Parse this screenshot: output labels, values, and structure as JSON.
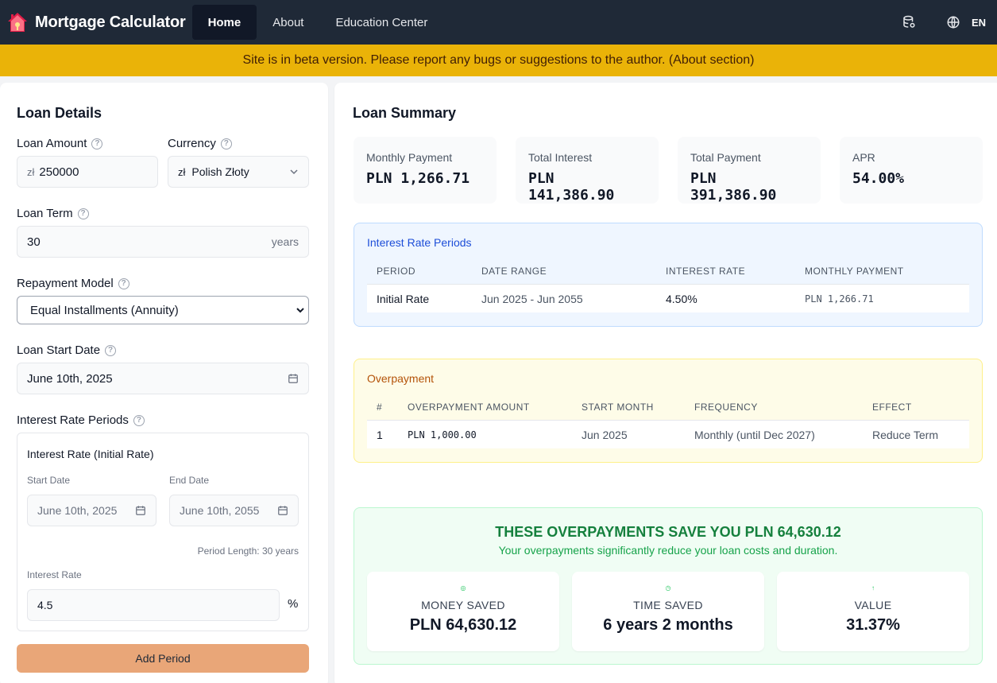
{
  "nav": {
    "brand": "Mortgage Calculator",
    "links": [
      "Home",
      "About",
      "Education Center"
    ],
    "lang": "EN"
  },
  "banner": "Site is in beta version. Please report any bugs or suggestions to the author. (About section)",
  "loan_details": {
    "title": "Loan Details",
    "loan_amount_label": "Loan Amount",
    "loan_amount_prefix": "zł",
    "loan_amount_value": "250000",
    "currency_label": "Currency",
    "currency_prefix": "zł",
    "currency_value": "Polish Złoty",
    "loan_term_label": "Loan Term",
    "loan_term_value": "30",
    "loan_term_unit": "years",
    "repayment_label": "Repayment Model",
    "repayment_value": "Equal Installments (Annuity)",
    "start_date_label": "Loan Start Date",
    "start_date_value": "June 10th, 2025",
    "periods_label": "Interest Rate Periods",
    "period": {
      "title": "Interest Rate (Initial Rate)",
      "start_label": "Start Date",
      "start_value": "June 10th, 2025",
      "end_label": "End Date",
      "end_value": "June 10th, 2055",
      "length_text": "Period Length: 30 years",
      "rate_label": "Interest Rate",
      "rate_value": "4.5",
      "rate_unit": "%"
    },
    "add_period": "Add Period"
  },
  "summary": {
    "title": "Loan Summary",
    "cards": [
      {
        "label": "Monthly Payment",
        "value": "PLN 1,266.71"
      },
      {
        "label": "Total Interest",
        "value": "PLN 141,386.90"
      },
      {
        "label": "Total Payment",
        "value": "PLN 391,386.90"
      },
      {
        "label": "APR",
        "value": "54.00%"
      }
    ]
  },
  "rate_periods": {
    "title": "Interest Rate Periods",
    "headers": [
      "PERIOD",
      "DATE RANGE",
      "INTEREST RATE",
      "MONTHLY PAYMENT"
    ],
    "row": [
      "Initial Rate",
      "Jun 2025 - Jun 2055",
      "4.50%",
      "PLN 1,266.71"
    ]
  },
  "overpayment": {
    "title": "Overpayment",
    "headers": [
      "#",
      "OVERPAYMENT AMOUNT",
      "START MONTH",
      "FREQUENCY",
      "EFFECT"
    ],
    "row": [
      "1",
      "PLN 1,000.00",
      "Jun 2025",
      "Monthly (until Dec 2027)",
      "Reduce Term"
    ]
  },
  "savings": {
    "headline": "THESE OVERPAYMENTS SAVE YOU PLN 64,630.12",
    "subtext": "Your overpayments significantly reduce your loan costs and duration.",
    "cards": [
      {
        "label": "MONEY SAVED",
        "value": "PLN 64,630.12"
      },
      {
        "label": "TIME SAVED",
        "value": "6 years 2 months"
      },
      {
        "label": "VALUE",
        "value": "31.37%"
      }
    ]
  },
  "colors": {
    "nav": "#1f2937",
    "banner": "#eab308",
    "accent_green": "#15803d",
    "button": "#e9a678"
  }
}
